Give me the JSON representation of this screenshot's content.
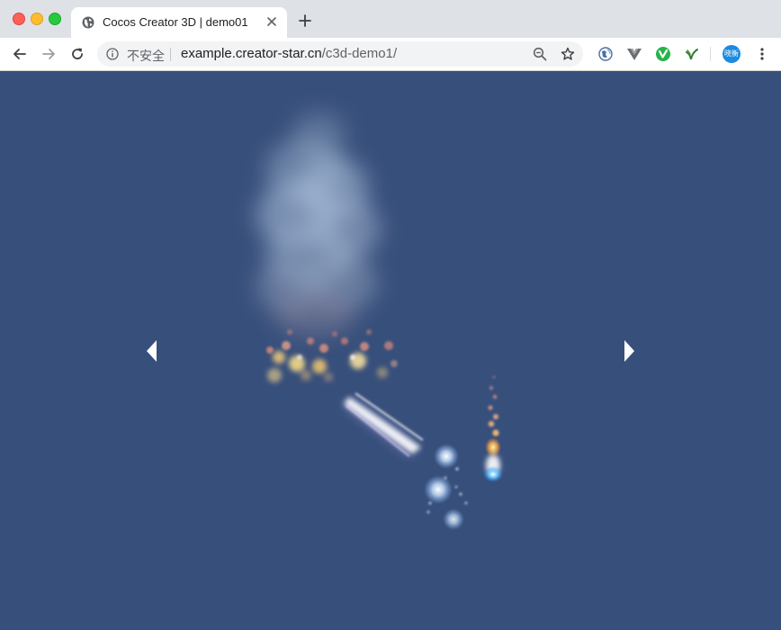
{
  "browser": {
    "tab": {
      "title": "Cocos Creator 3D | demo01"
    },
    "address_bar": {
      "security_label": "不安全",
      "url_host": "example.creator-star.cn",
      "url_path": "/c3d-demo1/"
    },
    "profile": {
      "label": "晓衡"
    }
  },
  "scene": {
    "background_color": "#374f7b",
    "nav": {
      "prev": "arrow-left",
      "next": "arrow-right"
    }
  }
}
